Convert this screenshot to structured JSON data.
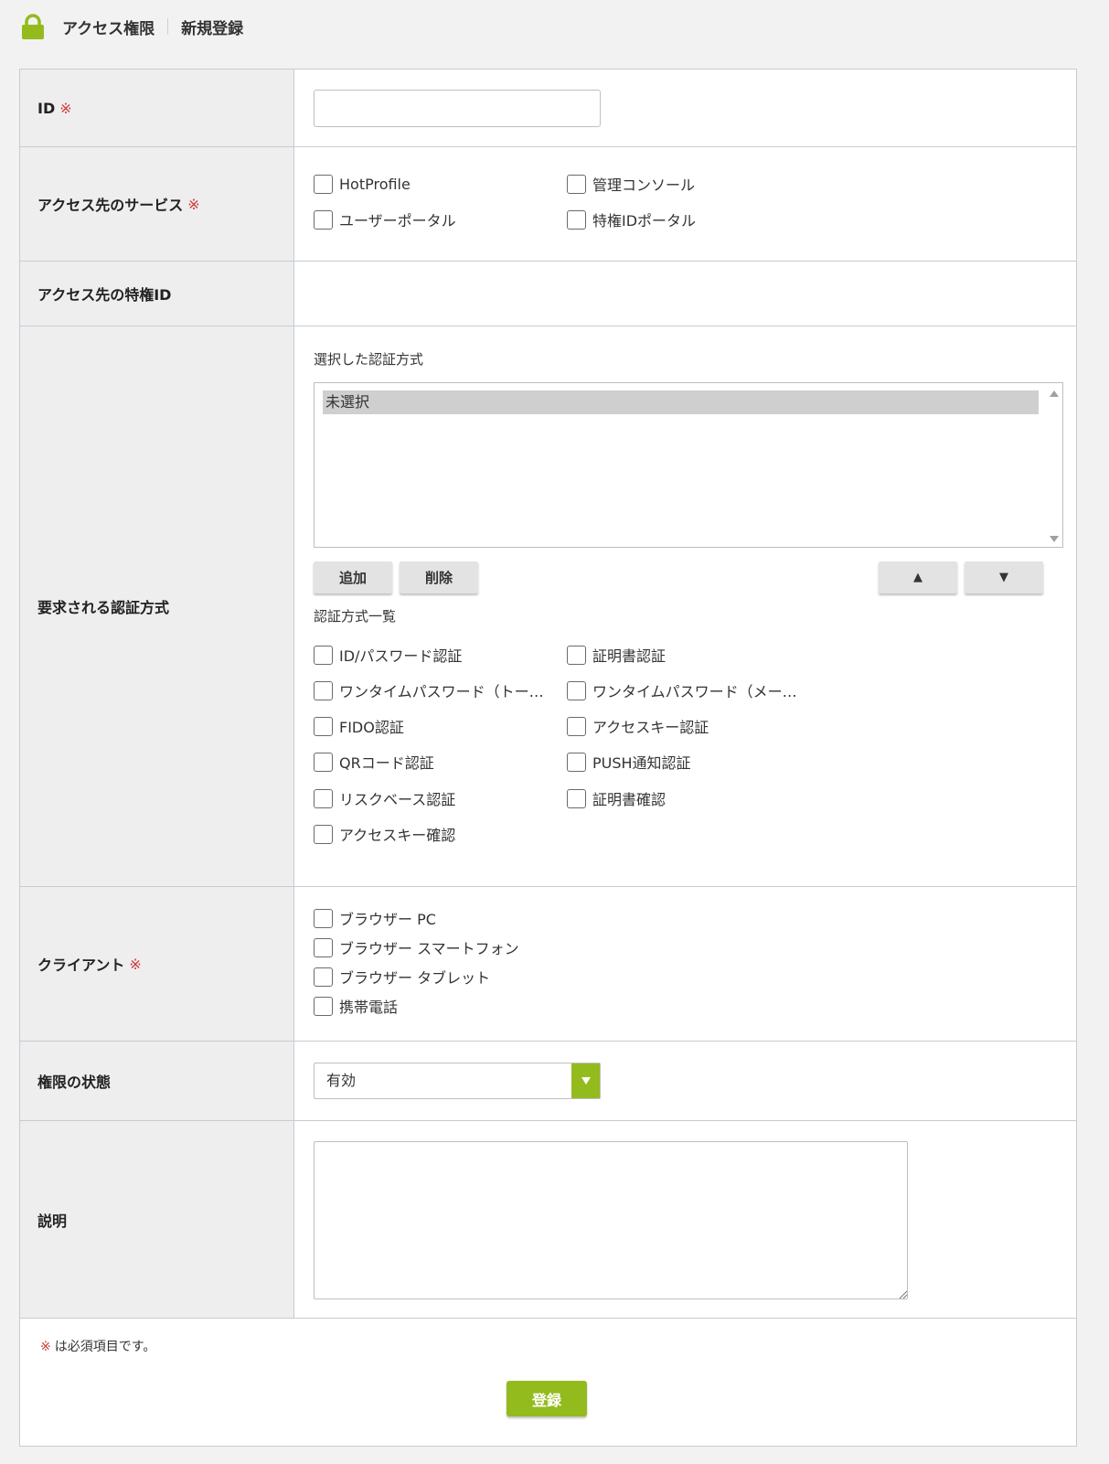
{
  "header": {
    "breadcrumb_parent": "アクセス権限",
    "breadcrumb_current": "新規登録",
    "icon": "lock-icon",
    "accent_color": "#93bb1e"
  },
  "form": {
    "required_mark": "※",
    "id": {
      "label": "ID",
      "value": ""
    },
    "services": {
      "label": "アクセス先のサービス",
      "options": [
        "HotProfile",
        "管理コンソール",
        "ユーザーポータル",
        "特権IDポータル"
      ]
    },
    "privileged_id": {
      "label": "アクセス先の特権ID"
    },
    "auth_methods": {
      "label": "要求される認証方式",
      "selected_label": "選択した認証方式",
      "selected_items": [
        "未選択"
      ],
      "add_button": "追加",
      "delete_button": "削除",
      "up_button": "▲",
      "down_button": "▼",
      "list_label": "認証方式一覧",
      "options": [
        "ID/パスワード認証",
        "証明書認証",
        "ワンタイムパスワード（トー…",
        "ワンタイムパスワード（メー…",
        "FIDO認証",
        "アクセスキー認証",
        "QRコード認証",
        "PUSH通知認証",
        "リスクベース認証",
        "証明書確認",
        "アクセスキー確認"
      ]
    },
    "client": {
      "label": "クライアント",
      "options": [
        "ブラウザー PC",
        "ブラウザー スマートフォン",
        "ブラウザー タブレット",
        "携帯電話"
      ]
    },
    "status": {
      "label": "権限の状態",
      "value": "有効"
    },
    "description": {
      "label": "説明",
      "value": ""
    },
    "note": "は必須項目です。",
    "submit_button": "登録"
  }
}
